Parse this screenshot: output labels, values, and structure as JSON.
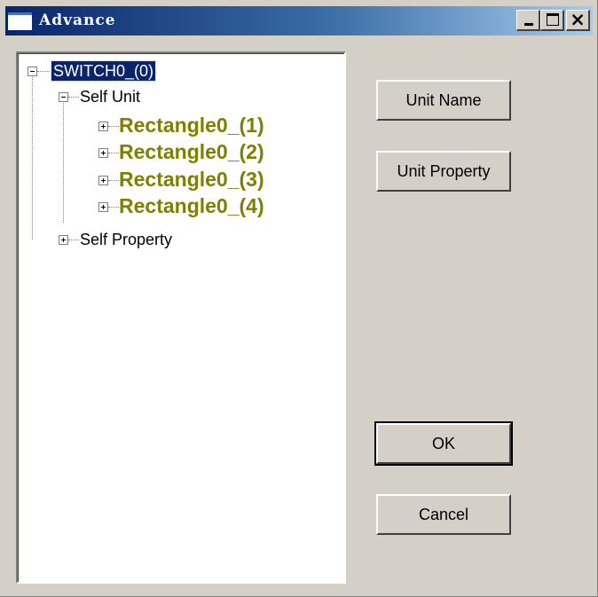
{
  "window": {
    "title": "Advance",
    "title_color": "#ffffff",
    "titlebar_gradient": [
      "#0a246a",
      "#a6caf0"
    ],
    "controls": [
      "minimize",
      "maximize",
      "close"
    ],
    "close_glyph": "×"
  },
  "tree": {
    "root": {
      "label": "SWITCH0_(0)",
      "expanded": true,
      "selected": true
    },
    "self_unit": {
      "label": "Self Unit",
      "expanded": true
    },
    "units": [
      {
        "label": "Rectangle0_(1)",
        "expanded": false
      },
      {
        "label": "Rectangle0_(2)",
        "expanded": false
      },
      {
        "label": "Rectangle0_(3)",
        "expanded": false
      },
      {
        "label": "Rectangle0_(4)",
        "expanded": false
      }
    ],
    "self_property": {
      "label": "Self Property",
      "expanded": false
    },
    "unit_color": "#808000"
  },
  "buttons": {
    "unit_name": "Unit Name",
    "unit_property": "Unit Property",
    "ok": "OK",
    "cancel": "Cancel"
  }
}
